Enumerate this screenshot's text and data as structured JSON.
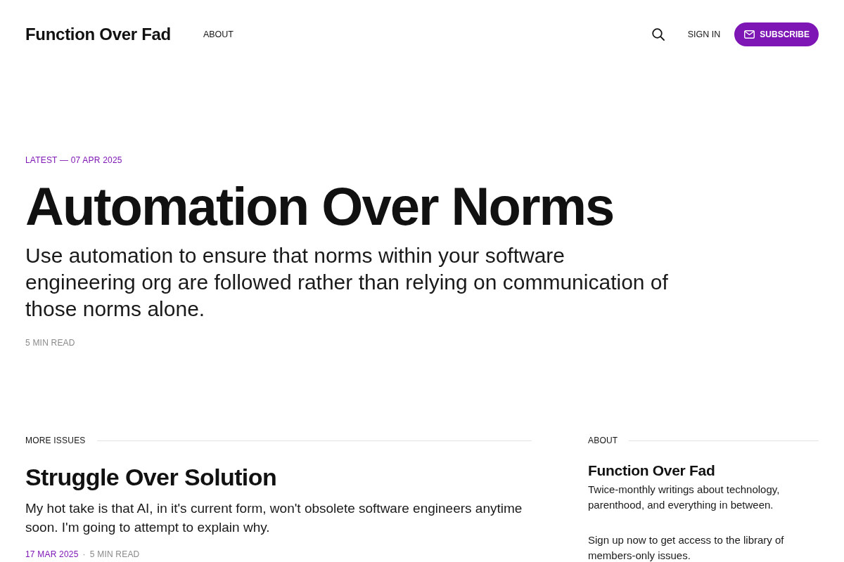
{
  "header": {
    "logo": "Function Over Fad",
    "nav": [
      "ABOUT"
    ],
    "sign_in": "SIGN IN",
    "subscribe": "SUBSCRIBE"
  },
  "hero": {
    "kicker": "LATEST — 07 APR 2025",
    "title": "Automation Over Norms",
    "excerpt": "Use automation to ensure that norms within your software engineering org are followed rather than relying on communication of those norms alone.",
    "reading_time": "5 MIN READ"
  },
  "more_issues": {
    "heading": "MORE ISSUES",
    "posts": [
      {
        "title": "Struggle Over Solution",
        "excerpt": "My hot take is that AI, in it's current form, won't obsolete software engineers anytime soon. I'm going to attempt to explain why.",
        "date": "17 MAR 2025",
        "separator": "·",
        "reading_time": "5 MIN READ"
      }
    ]
  },
  "about": {
    "heading": "ABOUT",
    "title": "Function Over Fad",
    "paragraphs": [
      "Twice-monthly writings about technology, parenthood, and everything in between.",
      "Sign up now to get access to the library of members-only issues."
    ]
  }
}
